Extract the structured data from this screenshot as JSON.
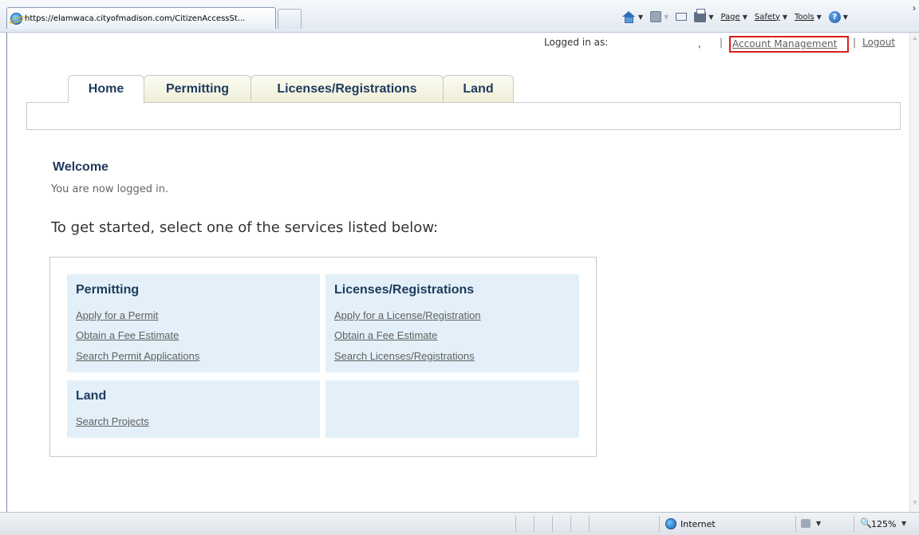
{
  "browser": {
    "tab_url": "https://elamwaca.cityofmadison.com/CitizenAccessSt...",
    "commands": {
      "page": "Page",
      "safety": "Safety",
      "tools": "Tools"
    },
    "status": {
      "zone": "Internet",
      "zoom": "125%"
    }
  },
  "userbar": {
    "logged_in_label": "Logged in as:",
    "username_mark": ",",
    "separator": "|",
    "account_management": "Account Management",
    "logout": "Logout",
    "highlight_color": "#d81e1e"
  },
  "nav": {
    "tabs": [
      {
        "label": "Home",
        "active": true
      },
      {
        "label": "Permitting",
        "active": false
      },
      {
        "label": "Licenses/Registrations",
        "active": false
      },
      {
        "label": "Land",
        "active": false
      }
    ]
  },
  "welcome": {
    "title": "Welcome",
    "message": "You are now logged in.",
    "instruction": "To get started, select one of the services listed below:"
  },
  "services": [
    {
      "title": "Permitting",
      "links": [
        "Apply for a Permit",
        "Obtain a Fee Estimate",
        "Search Permit Applications"
      ]
    },
    {
      "title": "Licenses/Registrations",
      "links": [
        "Apply for a License/Registration",
        "Obtain a Fee Estimate",
        "Search Licenses/Registrations"
      ]
    },
    {
      "title": "Land",
      "links": [
        "Search Projects"
      ]
    }
  ],
  "colors": {
    "heading": "#1e3a5c",
    "link": "#606060",
    "panel_bg": "#e3f0f9"
  }
}
